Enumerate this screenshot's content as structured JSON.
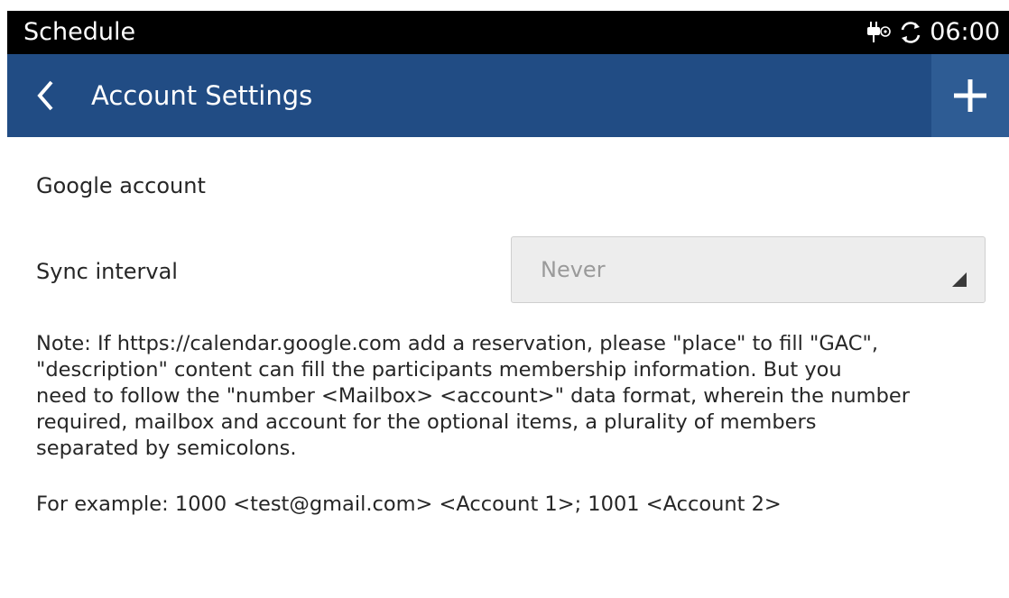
{
  "status_bar": {
    "title": "Schedule",
    "time": "06:00",
    "icons": [
      "charging-icon",
      "sync-icon"
    ]
  },
  "action_bar": {
    "title": "Account Settings",
    "back_icon": "chevron-left-icon",
    "add_icon": "plus-icon",
    "color": "#214c84"
  },
  "content": {
    "google_account_label": "Google account",
    "sync_interval_label": "Sync interval",
    "sync_interval_value": "Never",
    "note_lines": [
      "Note: If https://calendar.google.com add a reservation, please \"place\" to fill \"GAC\",",
      "\"description\" content can fill the participants membership information. But you",
      "need to follow the \"number <Mailbox> <account>\" data format, wherein the number",
      "required, mailbox and account for the optional items, a plurality of members",
      "separated by semicolons."
    ],
    "example": "For example: 1000 <test@gmail.com> <Account 1>; 1001 <Account 2>"
  }
}
